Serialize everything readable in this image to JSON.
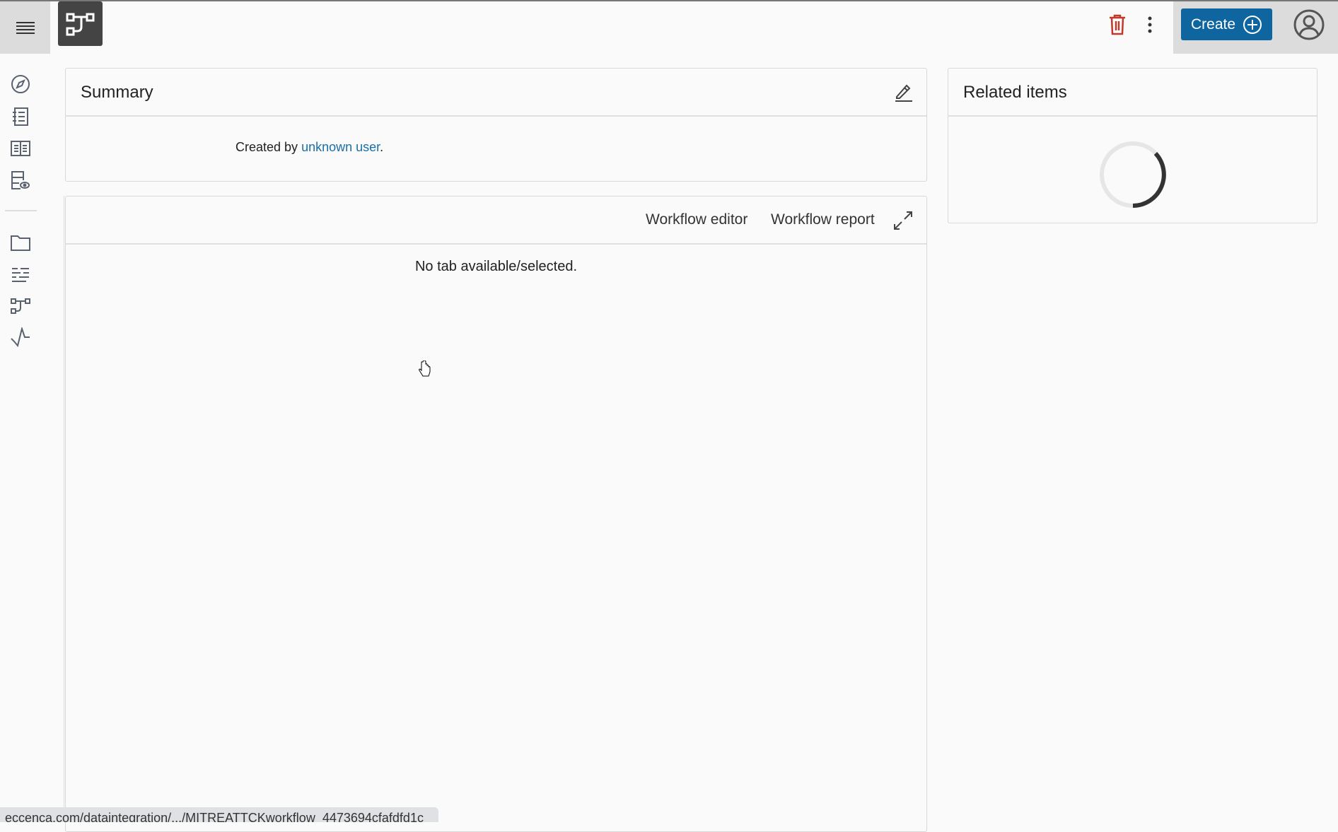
{
  "header": {
    "create_label": "Create",
    "icons": [
      "menu-icon",
      "workflow-logo-icon",
      "trash-icon",
      "more-vertical-icon",
      "add-circle-icon",
      "user-avatar-icon"
    ],
    "create_color": "#0e65a0",
    "trash_color": "#c0392b"
  },
  "sidebar": {
    "items": [
      "explore-icon",
      "notebook-icon",
      "reading-icon",
      "dataset-preview-icon",
      "folder-icon",
      "transform-icon",
      "workflow-icon",
      "activity-icon"
    ]
  },
  "summary": {
    "title": "Summary",
    "created_prefix": "Created by ",
    "created_user": "unknown user",
    "created_suffix": "."
  },
  "workflow": {
    "tabs": [
      "Workflow editor",
      "Workflow report"
    ],
    "empty_message": "No tab available/selected."
  },
  "related": {
    "title": "Related items"
  },
  "statusbar": {
    "url": "eccenca.com/dataintegration/.../MITREATTCKworkflow_4473694cfafdfd1c"
  }
}
